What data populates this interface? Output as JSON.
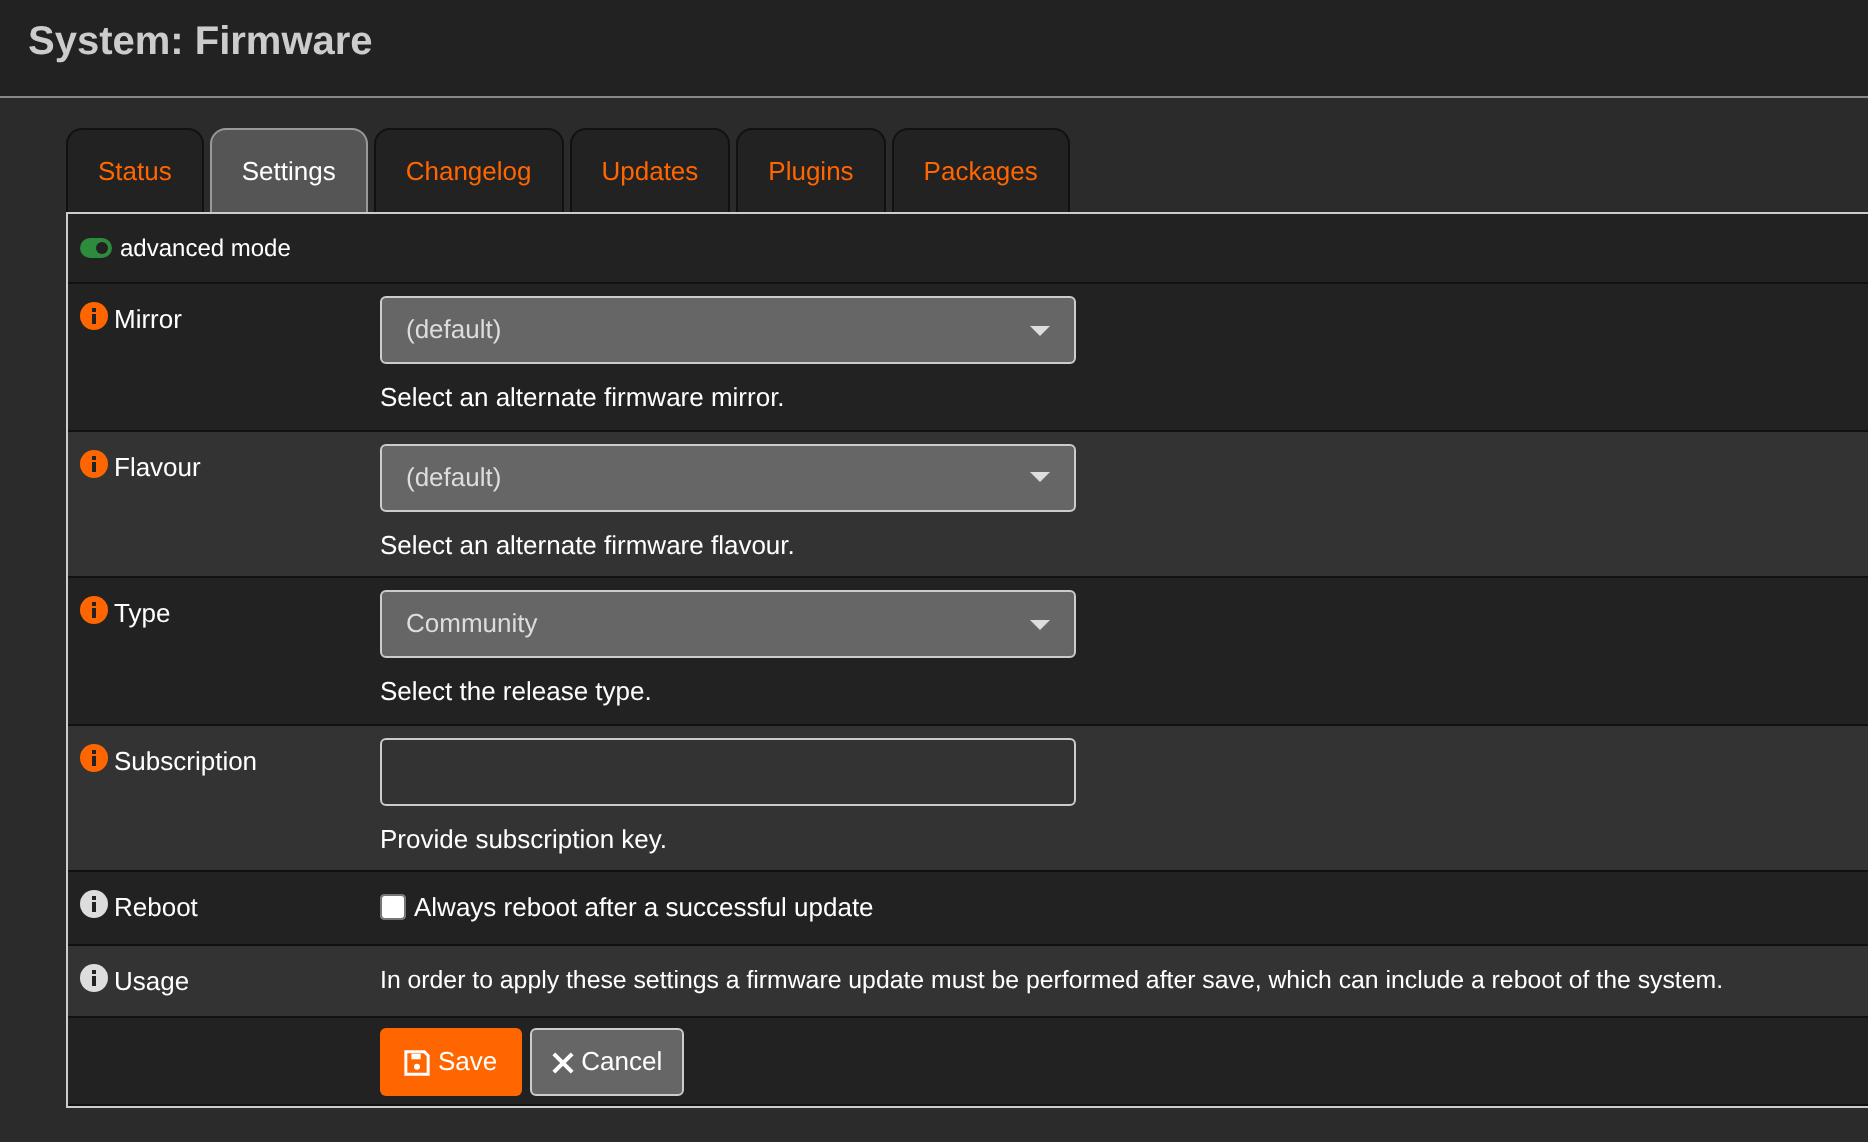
{
  "page": {
    "title": "System: Firmware"
  },
  "tabs": [
    {
      "label": "Status",
      "selected": false
    },
    {
      "label": "Settings",
      "selected": true
    },
    {
      "label": "Changelog",
      "selected": false
    },
    {
      "label": "Updates",
      "selected": false
    },
    {
      "label": "Plugins",
      "selected": false
    },
    {
      "label": "Packages",
      "selected": false
    }
  ],
  "advanced_mode": {
    "label": "advanced mode",
    "on": true
  },
  "rows": [
    {
      "kind": "select",
      "label": "Mirror",
      "color": "#ff6600",
      "value": "(default)",
      "help": "Select an alternate firmware mirror."
    },
    {
      "kind": "select",
      "label": "Flavour",
      "color": "#ff6600",
      "value": "(default)",
      "help": "Select an alternate firmware flavour."
    },
    {
      "kind": "select",
      "label": "Type",
      "color": "#ff6600",
      "value": "Community",
      "help": "Select the release type."
    },
    {
      "kind": "text",
      "label": "Subscription",
      "color": "#ff6600",
      "help": "Provide subscription key."
    },
    {
      "kind": "checkbox",
      "label": "Reboot",
      "color": "#dddddd",
      "text": "Always reboot after a successful update",
      "checked": false
    },
    {
      "kind": "info",
      "label": "Usage",
      "color": "#dddddd",
      "text": "In order to apply these settings a firmware update must be performed after save, which can include a reboot of the system."
    }
  ],
  "buttons": [
    {
      "kind": "save",
      "label": "Save"
    },
    {
      "kind": "cancel",
      "label": "Cancel"
    }
  ]
}
